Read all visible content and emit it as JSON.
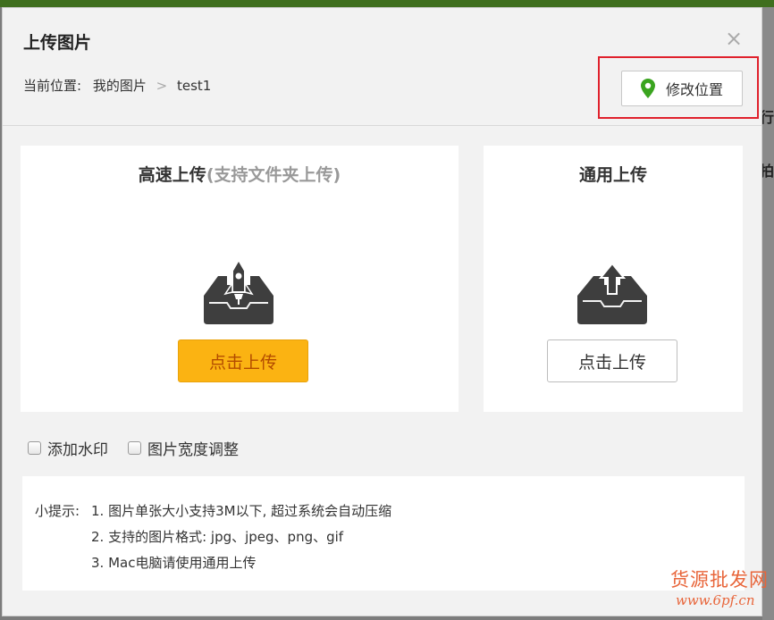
{
  "dialog": {
    "title": "上传图片",
    "close_glyph": "×",
    "breadcrumb": {
      "prefix": "当前位置:",
      "root": "我的图片",
      "separator": ">",
      "current": "test1"
    },
    "change_location_label": "修改位置",
    "location_icon": "map-pin-icon",
    "location_icon_color": "#3aa41f"
  },
  "fast_upload": {
    "title": "高速上传",
    "subtitle": "(支持文件夹上传)",
    "icon": "rocket-upload-icon",
    "button_label": "点击上传"
  },
  "normal_upload": {
    "title": "通用上传",
    "icon": "tray-upload-icon",
    "button_label": "点击上传"
  },
  "options": {
    "watermark_label": "添加水印",
    "resize_label": "图片宽度调整"
  },
  "tips": {
    "prefix": "小提示:",
    "line1": "1. 图片单张大小支持3M以下, 超过系统会自动压缩",
    "line2": "2. 支持的图片格式: jpg、jpeg、png、gif",
    "line3": "3. Mac电脑请使用通用上传"
  },
  "background": {
    "text1": "行",
    "text2": "拍"
  },
  "watermark": {
    "cn": "货源批发网",
    "url": "www.6pf.cn"
  }
}
